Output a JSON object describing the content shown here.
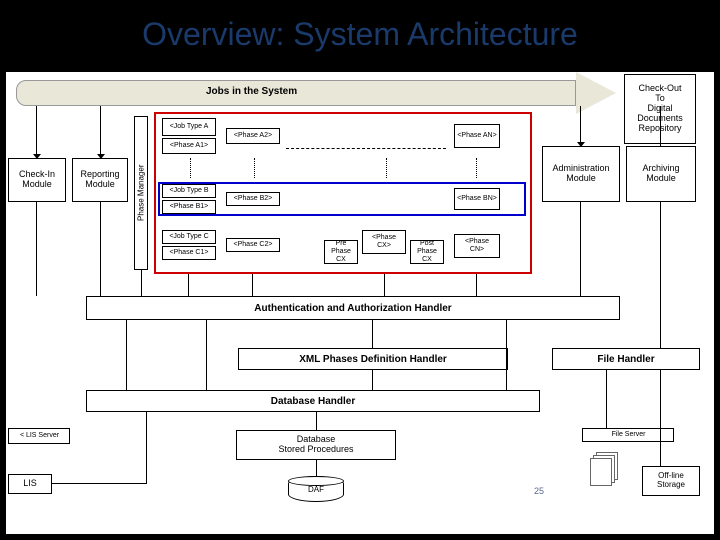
{
  "title": "Overview: System Architecture",
  "arrow_label": "Jobs in the System",
  "modules": {
    "checkin": "Check-In\nModule",
    "reporting": "Reporting\nModule",
    "admin": "Administration\nModule",
    "archiving": "Archiving\nModule",
    "checkout": "Check-Out\nTo\nDigital\nDocuments\nRepository"
  },
  "phase_mgr": "Phase Manager",
  "job_types": {
    "a": "<Job Type A",
    "a1": "<Phase A1>",
    "a2": "<Phase A2>",
    "an": "<Phase AN>",
    "b": "<Job Type B",
    "b1": "<Phase B1>",
    "b2": "<Phase B2>",
    "bn": "<Phase BN>",
    "c": "<Job Type C",
    "c1": "<Phase C1>",
    "c2": "<Phase C2>",
    "cx": "<Phase CX>",
    "cn": "<Phase CN>",
    "pre": "Pre Phase CX",
    "post": "Post Phase CX"
  },
  "handlers": {
    "auth": "Authentication and Authorization Handler",
    "xml": "XML Phases Definition Handler",
    "file": "File Handler",
    "db": "Database Handler",
    "sproc": "Database\nStored Procedures"
  },
  "servers": {
    "lis_srv": "< LIS Server",
    "lis": "LIS",
    "file_srv": "File Server",
    "offline": "Off-line\nStorage"
  },
  "db": {
    "daf": "DAF"
  },
  "page_num": "25"
}
